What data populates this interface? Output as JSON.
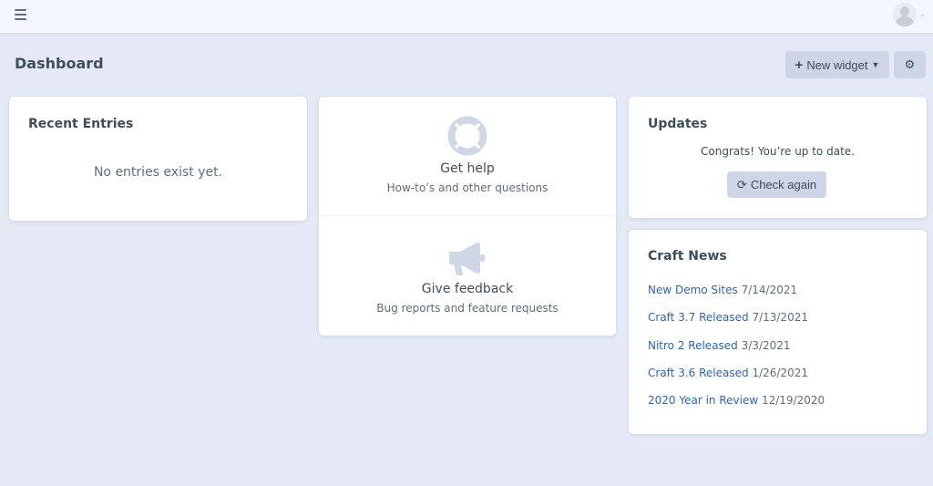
{
  "header": {
    "menu_icon": "hamburger-icon",
    "account_icon": "user-avatar-icon"
  },
  "page": {
    "title": "Dashboard"
  },
  "toolbar": {
    "new_widget_label": "New widget",
    "new_widget_icon": "plus-icon",
    "settings_icon": "gear-icon"
  },
  "widgets": {
    "recent_entries": {
      "title": "Recent Entries",
      "empty_message": "No entries exist yet."
    },
    "help": {
      "items": [
        {
          "icon": "life-ring-icon",
          "title": "Get help",
          "subtitle": "How-to’s and other questions"
        },
        {
          "icon": "megaphone-icon",
          "title": "Give feedback",
          "subtitle": "Bug reports and feature requests"
        }
      ]
    },
    "updates": {
      "title": "Updates",
      "message": "Congrats! You’re up to date.",
      "check_label": "Check again",
      "check_icon": "refresh-icon"
    },
    "news": {
      "title": "Craft News",
      "items": [
        {
          "title": "New Demo Sites",
          "date": "7/14/2021"
        },
        {
          "title": "Craft 3.7 Released",
          "date": "7/13/2021"
        },
        {
          "title": "Nitro 2 Released",
          "date": "3/3/2021"
        },
        {
          "title": "Craft 3.6 Released",
          "date": "1/26/2021"
        },
        {
          "title": "2020 Year in Review",
          "date": "12/19/2020"
        }
      ]
    }
  },
  "colors": {
    "background": "#e4e9f5",
    "link": "#2e65b1",
    "button": "#cdd5e6",
    "icon_muted": "#cfd6e6"
  }
}
